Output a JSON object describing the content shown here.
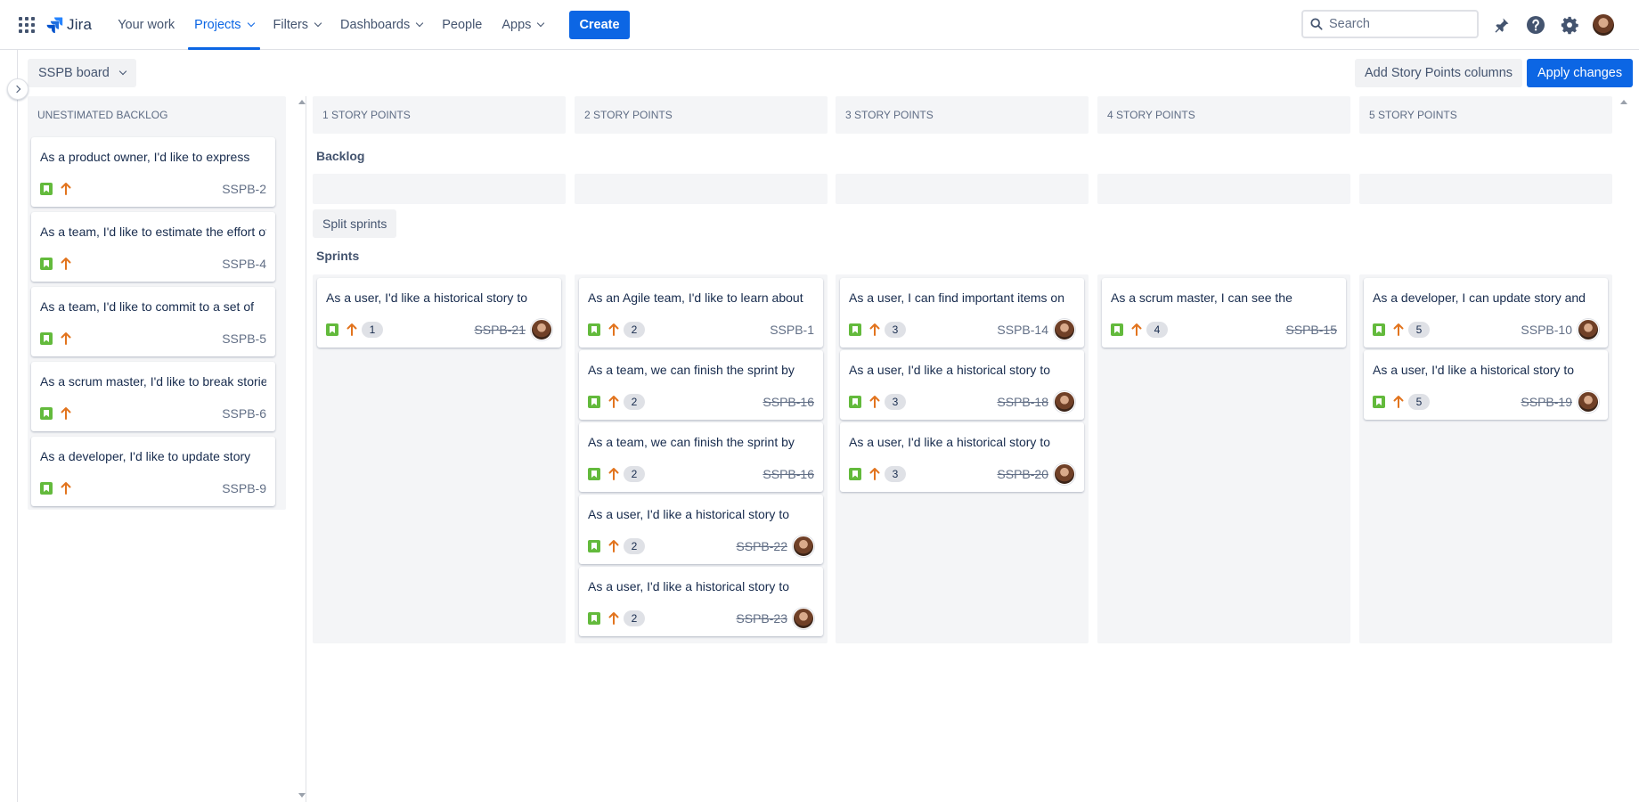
{
  "topnav": {
    "product": "Jira",
    "items": [
      {
        "label": "Your work",
        "dropdown": false,
        "active": false
      },
      {
        "label": "Projects",
        "dropdown": true,
        "active": true
      },
      {
        "label": "Filters",
        "dropdown": true,
        "active": false
      },
      {
        "label": "Dashboards",
        "dropdown": true,
        "active": false
      },
      {
        "label": "People",
        "dropdown": false,
        "active": false
      },
      {
        "label": "Apps",
        "dropdown": true,
        "active": false
      }
    ],
    "create_label": "Create",
    "search_placeholder": "Search",
    "icons": [
      "notifications-icon",
      "help-icon",
      "settings-icon",
      "profile-avatar"
    ]
  },
  "toolbar": {
    "board_label": "SSPB board",
    "add_columns_label": "Add Story Points columns",
    "apply_label": "Apply changes"
  },
  "colors": {
    "accent": "#0c66e4",
    "story": "#63ba3c",
    "priority": "#e2741e",
    "column_bg": "#f4f5f7"
  },
  "backlog_column": {
    "title": "UNESTIMATED BACKLOG",
    "cards": [
      {
        "summary": "As a product owner, I'd like to express",
        "key": "SSPB-2"
      },
      {
        "summary": "As a team, I'd like to estimate the effort of",
        "key": "SSPB-4"
      },
      {
        "summary": "As a team, I'd like to commit to a set of",
        "key": "SSPB-5"
      },
      {
        "summary": "As a scrum master, I'd like to break stories",
        "key": "SSPB-6"
      },
      {
        "summary": "As a developer, I'd like to update story",
        "key": "SSPB-9"
      }
    ]
  },
  "sections": {
    "backlog_label": "Backlog",
    "split_label": "Split sprints",
    "sprints_label": "Sprints"
  },
  "sp_columns": [
    {
      "title": "1 STORY POINTS",
      "cards": [
        {
          "summary": "As a user, I'd like a historical story to",
          "points": "1",
          "key": "SSPB-21",
          "done": true,
          "assignee": true
        }
      ]
    },
    {
      "title": "2 STORY POINTS",
      "cards": [
        {
          "summary": "As an Agile team, I'd like to learn about",
          "points": "2",
          "key": "SSPB-1",
          "done": false,
          "assignee": false
        },
        {
          "summary": "As a team, we can finish the sprint by",
          "points": "2",
          "key": "SSPB-16",
          "done": true,
          "assignee": false
        },
        {
          "summary": "As a team, we can finish the sprint by",
          "points": "2",
          "key": "SSPB-16",
          "done": true,
          "assignee": false
        },
        {
          "summary": "As a user, I'd like a historical story to",
          "points": "2",
          "key": "SSPB-22",
          "done": true,
          "assignee": true
        },
        {
          "summary": "As a user, I'd like a historical story to",
          "points": "2",
          "key": "SSPB-23",
          "done": true,
          "assignee": true
        }
      ]
    },
    {
      "title": "3 STORY POINTS",
      "cards": [
        {
          "summary": "As a user, I can find important items on",
          "points": "3",
          "key": "SSPB-14",
          "done": false,
          "assignee": true
        },
        {
          "summary": "As a user, I'd like a historical story to",
          "points": "3",
          "key": "SSPB-18",
          "done": true,
          "assignee": true
        },
        {
          "summary": "As a user, I'd like a historical story to",
          "points": "3",
          "key": "SSPB-20",
          "done": true,
          "assignee": true
        }
      ]
    },
    {
      "title": "4 STORY POINTS",
      "cards": [
        {
          "summary": "As a scrum master, I can see the",
          "points": "4",
          "key": "SSPB-15",
          "done": true,
          "assignee": false
        }
      ]
    },
    {
      "title": "5 STORY POINTS",
      "cards": [
        {
          "summary": "As a developer, I can update story and",
          "points": "5",
          "key": "SSPB-10",
          "done": false,
          "assignee": true
        },
        {
          "summary": "As a user, I'd like a historical story to",
          "points": "5",
          "key": "SSPB-19",
          "done": true,
          "assignee": true
        }
      ]
    }
  ]
}
